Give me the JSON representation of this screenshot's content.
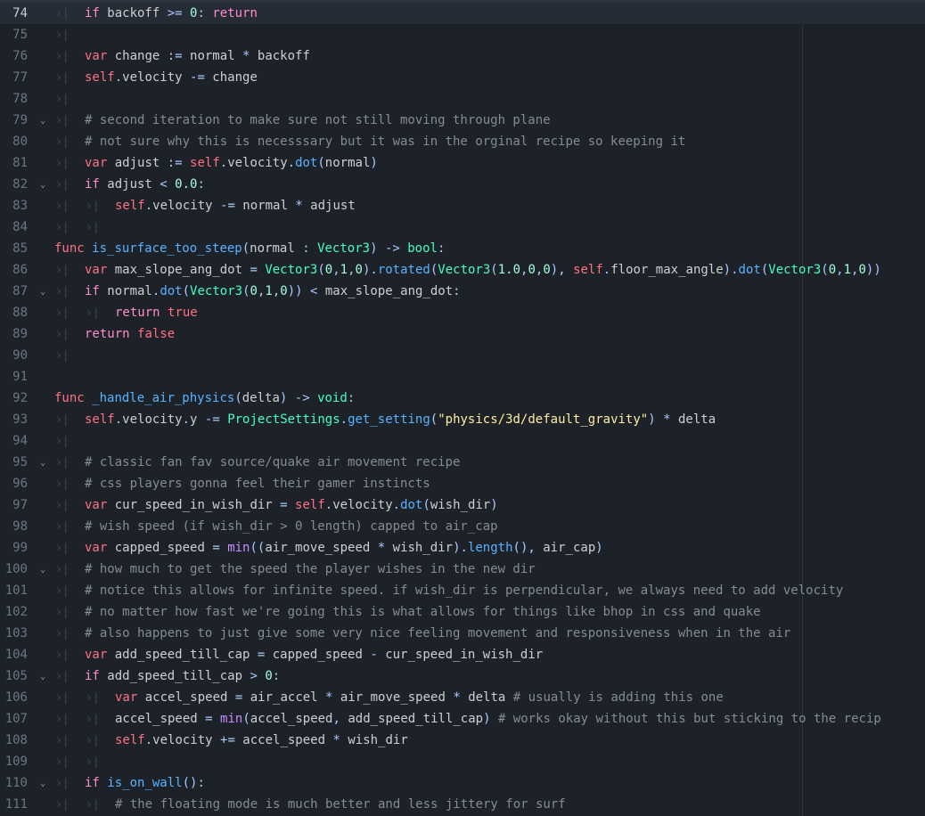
{
  "colors": {
    "background": "#1d2229",
    "current_line": "#262c35",
    "keyword": "#ff7085",
    "control_flow": "#ff8ccc",
    "function": "#57b3ff",
    "type": "#42ffc2",
    "number": "#a1ffe0",
    "string": "#ffeda1",
    "comment": "#858b94",
    "symbol": "#abc9ff",
    "text": "#cdcfd2"
  },
  "tab_marker_glyph": "›|",
  "fold_glyph": "⌄",
  "lines": [
    {
      "n": "74",
      "indent": 1,
      "current": true,
      "t": [
        [
          "ctrl",
          "if"
        ],
        [
          "plain",
          " backoff "
        ],
        [
          "sym",
          ">="
        ],
        [
          "plain",
          " "
        ],
        [
          "num",
          "0"
        ],
        [
          "sym",
          ":"
        ],
        [
          "plain",
          " "
        ],
        [
          "ctrl",
          "return"
        ]
      ]
    },
    {
      "n": "75",
      "indent": 1,
      "t": []
    },
    {
      "n": "76",
      "indent": 1,
      "t": [
        [
          "kw",
          "var"
        ],
        [
          "plain",
          " change "
        ],
        [
          "sym",
          ":="
        ],
        [
          "plain",
          " normal "
        ],
        [
          "sym",
          "*"
        ],
        [
          "plain",
          " backoff"
        ]
      ]
    },
    {
      "n": "77",
      "indent": 1,
      "t": [
        [
          "kw",
          "self"
        ],
        [
          "sym",
          "."
        ],
        [
          "plain",
          "velocity "
        ],
        [
          "sym",
          "-="
        ],
        [
          "plain",
          " change"
        ]
      ]
    },
    {
      "n": "78",
      "indent": 1,
      "t": []
    },
    {
      "n": "79",
      "indent": 1,
      "fold": true,
      "t": [
        [
          "comment",
          "# second iteration to make sure not still moving through plane"
        ]
      ]
    },
    {
      "n": "80",
      "indent": 1,
      "t": [
        [
          "comment",
          "# not sure why this is necesssary but it was in the orginal recipe so keeping it"
        ]
      ]
    },
    {
      "n": "81",
      "indent": 1,
      "t": [
        [
          "kw",
          "var"
        ],
        [
          "plain",
          " adjust "
        ],
        [
          "sym",
          ":="
        ],
        [
          "plain",
          " "
        ],
        [
          "kw",
          "self"
        ],
        [
          "sym",
          "."
        ],
        [
          "plain",
          "velocity"
        ],
        [
          "sym",
          "."
        ],
        [
          "method",
          "dot"
        ],
        [
          "sym",
          "("
        ],
        [
          "plain",
          "normal"
        ],
        [
          "sym",
          ")"
        ]
      ]
    },
    {
      "n": "82",
      "indent": 1,
      "fold": true,
      "t": [
        [
          "ctrl",
          "if"
        ],
        [
          "plain",
          " adjust "
        ],
        [
          "sym",
          "<"
        ],
        [
          "plain",
          " "
        ],
        [
          "num",
          "0.0"
        ],
        [
          "sym",
          ":"
        ]
      ]
    },
    {
      "n": "83",
      "indent": 2,
      "t": [
        [
          "kw",
          "self"
        ],
        [
          "sym",
          "."
        ],
        [
          "plain",
          "velocity "
        ],
        [
          "sym",
          "-="
        ],
        [
          "plain",
          " normal "
        ],
        [
          "sym",
          "*"
        ],
        [
          "plain",
          " adjust"
        ]
      ]
    },
    {
      "n": "84",
      "indent": 2,
      "t": []
    },
    {
      "n": "85",
      "indent": 0,
      "t": [
        [
          "kw",
          "func"
        ],
        [
          "plain",
          " "
        ],
        [
          "func",
          "is_surface_too_steep"
        ],
        [
          "sym",
          "("
        ],
        [
          "plain",
          "normal "
        ],
        [
          "sym",
          ":"
        ],
        [
          "plain",
          " "
        ],
        [
          "type",
          "Vector3"
        ],
        [
          "sym",
          ")"
        ],
        [
          "plain",
          " "
        ],
        [
          "sym",
          "->"
        ],
        [
          "plain",
          " "
        ],
        [
          "type",
          "bool"
        ],
        [
          "sym",
          ":"
        ]
      ]
    },
    {
      "n": "86",
      "indent": 1,
      "t": [
        [
          "kw",
          "var"
        ],
        [
          "plain",
          " max_slope_ang_dot "
        ],
        [
          "sym",
          "="
        ],
        [
          "plain",
          " "
        ],
        [
          "type",
          "Vector3"
        ],
        [
          "sym",
          "("
        ],
        [
          "num",
          "0"
        ],
        [
          "sym",
          ","
        ],
        [
          "num",
          "1"
        ],
        [
          "sym",
          ","
        ],
        [
          "num",
          "0"
        ],
        [
          "sym",
          ")."
        ],
        [
          "method",
          "rotated"
        ],
        [
          "sym",
          "("
        ],
        [
          "type",
          "Vector3"
        ],
        [
          "sym",
          "("
        ],
        [
          "num",
          "1.0"
        ],
        [
          "sym",
          ","
        ],
        [
          "num",
          "0"
        ],
        [
          "sym",
          ","
        ],
        [
          "num",
          "0"
        ],
        [
          "sym",
          "),"
        ],
        [
          "plain",
          " "
        ],
        [
          "kw",
          "self"
        ],
        [
          "sym",
          "."
        ],
        [
          "plain",
          "floor_max_angle"
        ],
        [
          "sym",
          ")."
        ],
        [
          "method",
          "dot"
        ],
        [
          "sym",
          "("
        ],
        [
          "type",
          "Vector3"
        ],
        [
          "sym",
          "("
        ],
        [
          "num",
          "0"
        ],
        [
          "sym",
          ","
        ],
        [
          "num",
          "1"
        ],
        [
          "sym",
          ","
        ],
        [
          "num",
          "0"
        ],
        [
          "sym",
          "))"
        ]
      ]
    },
    {
      "n": "87",
      "indent": 1,
      "fold": true,
      "t": [
        [
          "ctrl",
          "if"
        ],
        [
          "plain",
          " normal"
        ],
        [
          "sym",
          "."
        ],
        [
          "method",
          "dot"
        ],
        [
          "sym",
          "("
        ],
        [
          "type",
          "Vector3"
        ],
        [
          "sym",
          "("
        ],
        [
          "num",
          "0"
        ],
        [
          "sym",
          ","
        ],
        [
          "num",
          "1"
        ],
        [
          "sym",
          ","
        ],
        [
          "num",
          "0"
        ],
        [
          "sym",
          "))"
        ],
        [
          "plain",
          " "
        ],
        [
          "sym",
          "<"
        ],
        [
          "plain",
          " max_slope_ang_dot"
        ],
        [
          "sym",
          ":"
        ]
      ]
    },
    {
      "n": "88",
      "indent": 2,
      "t": [
        [
          "ctrl",
          "return"
        ],
        [
          "plain",
          " "
        ],
        [
          "kw",
          "true"
        ]
      ]
    },
    {
      "n": "89",
      "indent": 1,
      "t": [
        [
          "ctrl",
          "return"
        ],
        [
          "plain",
          " "
        ],
        [
          "kw",
          "false"
        ]
      ]
    },
    {
      "n": "90",
      "indent": 1,
      "t": []
    },
    {
      "n": "91",
      "indent": 0,
      "t": []
    },
    {
      "n": "92",
      "indent": 0,
      "t": [
        [
          "kw",
          "func"
        ],
        [
          "plain",
          " "
        ],
        [
          "func",
          "_handle_air_physics"
        ],
        [
          "sym",
          "("
        ],
        [
          "plain",
          "delta"
        ],
        [
          "sym",
          ")"
        ],
        [
          "plain",
          " "
        ],
        [
          "sym",
          "->"
        ],
        [
          "plain",
          " "
        ],
        [
          "type",
          "void"
        ],
        [
          "sym",
          ":"
        ]
      ]
    },
    {
      "n": "93",
      "indent": 1,
      "t": [
        [
          "kw",
          "self"
        ],
        [
          "sym",
          "."
        ],
        [
          "plain",
          "velocity"
        ],
        [
          "sym",
          "."
        ],
        [
          "plain",
          "y "
        ],
        [
          "sym",
          "-="
        ],
        [
          "plain",
          " "
        ],
        [
          "type",
          "ProjectSettings"
        ],
        [
          "sym",
          "."
        ],
        [
          "method",
          "get_setting"
        ],
        [
          "sym",
          "("
        ],
        [
          "str",
          "\"physics/3d/default_gravity\""
        ],
        [
          "sym",
          ")"
        ],
        [
          "plain",
          " "
        ],
        [
          "sym",
          "*"
        ],
        [
          "plain",
          " delta"
        ]
      ]
    },
    {
      "n": "94",
      "indent": 1,
      "t": []
    },
    {
      "n": "95",
      "indent": 1,
      "fold": true,
      "t": [
        [
          "comment",
          "# classic fan fav source/quake air movement recipe"
        ]
      ]
    },
    {
      "n": "96",
      "indent": 1,
      "t": [
        [
          "comment",
          "# css players gonna feel their gamer instincts"
        ]
      ]
    },
    {
      "n": "97",
      "indent": 1,
      "t": [
        [
          "kw",
          "var"
        ],
        [
          "plain",
          " cur_speed_in_wish_dir "
        ],
        [
          "sym",
          "="
        ],
        [
          "plain",
          " "
        ],
        [
          "kw",
          "self"
        ],
        [
          "sym",
          "."
        ],
        [
          "plain",
          "velocity"
        ],
        [
          "sym",
          "."
        ],
        [
          "method",
          "dot"
        ],
        [
          "sym",
          "("
        ],
        [
          "plain",
          "wish_dir"
        ],
        [
          "sym",
          ")"
        ]
      ]
    },
    {
      "n": "98",
      "indent": 1,
      "t": [
        [
          "comment",
          "# wish speed (if wish_dir > 0 length) capped to air_cap"
        ]
      ]
    },
    {
      "n": "99",
      "indent": 1,
      "t": [
        [
          "kw",
          "var"
        ],
        [
          "plain",
          " capped_speed "
        ],
        [
          "sym",
          "="
        ],
        [
          "plain",
          " "
        ],
        [
          "builtin",
          "min"
        ],
        [
          "sym",
          "(("
        ],
        [
          "plain",
          "air_move_speed "
        ],
        [
          "sym",
          "*"
        ],
        [
          "plain",
          " wish_dir"
        ],
        [
          "sym",
          ")."
        ],
        [
          "method",
          "length"
        ],
        [
          "sym",
          "(),"
        ],
        [
          "plain",
          " air_cap"
        ],
        [
          "sym",
          ")"
        ]
      ]
    },
    {
      "n": "100",
      "indent": 1,
      "fold": true,
      "t": [
        [
          "comment",
          "# how much to get the speed the player wishes in the new dir"
        ]
      ]
    },
    {
      "n": "101",
      "indent": 1,
      "t": [
        [
          "comment",
          "# notice this allows for infinite speed. if wish_dir is perpendicular, we always need to add velocity"
        ]
      ]
    },
    {
      "n": "102",
      "indent": 1,
      "t": [
        [
          "comment",
          "# no matter how fast we're going this is what allows for things like bhop in css and quake"
        ]
      ]
    },
    {
      "n": "103",
      "indent": 1,
      "t": [
        [
          "comment",
          "# also happens to just give some very nice feeling movement and responsiveness when in the air"
        ]
      ]
    },
    {
      "n": "104",
      "indent": 1,
      "t": [
        [
          "kw",
          "var"
        ],
        [
          "plain",
          " add_speed_till_cap "
        ],
        [
          "sym",
          "="
        ],
        [
          "plain",
          " capped_speed "
        ],
        [
          "sym",
          "-"
        ],
        [
          "plain",
          " cur_speed_in_wish_dir"
        ]
      ]
    },
    {
      "n": "105",
      "indent": 1,
      "fold": true,
      "t": [
        [
          "ctrl",
          "if"
        ],
        [
          "plain",
          " add_speed_till_cap "
        ],
        [
          "sym",
          ">"
        ],
        [
          "plain",
          " "
        ],
        [
          "num",
          "0"
        ],
        [
          "sym",
          ":"
        ]
      ]
    },
    {
      "n": "106",
      "indent": 2,
      "t": [
        [
          "kw",
          "var"
        ],
        [
          "plain",
          " accel_speed "
        ],
        [
          "sym",
          "="
        ],
        [
          "plain",
          " air_accel "
        ],
        [
          "sym",
          "*"
        ],
        [
          "plain",
          " air_move_speed "
        ],
        [
          "sym",
          "*"
        ],
        [
          "plain",
          " delta "
        ],
        [
          "comment",
          "# usually is adding this one"
        ]
      ]
    },
    {
      "n": "107",
      "indent": 2,
      "t": [
        [
          "plain",
          "accel_speed "
        ],
        [
          "sym",
          "="
        ],
        [
          "plain",
          " "
        ],
        [
          "builtin",
          "min"
        ],
        [
          "sym",
          "("
        ],
        [
          "plain",
          "accel_speed"
        ],
        [
          "sym",
          ","
        ],
        [
          "plain",
          " add_speed_till_cap"
        ],
        [
          "sym",
          ")"
        ],
        [
          "plain",
          " "
        ],
        [
          "comment",
          "# works okay without this but sticking to the recip"
        ]
      ]
    },
    {
      "n": "108",
      "indent": 2,
      "t": [
        [
          "kw",
          "self"
        ],
        [
          "sym",
          "."
        ],
        [
          "plain",
          "velocity "
        ],
        [
          "sym",
          "+="
        ],
        [
          "plain",
          " accel_speed "
        ],
        [
          "sym",
          "*"
        ],
        [
          "plain",
          " wish_dir"
        ]
      ]
    },
    {
      "n": "109",
      "indent": 2,
      "t": []
    },
    {
      "n": "110",
      "indent": 1,
      "fold": true,
      "t": [
        [
          "ctrl",
          "if"
        ],
        [
          "plain",
          " "
        ],
        [
          "method",
          "is_on_wall"
        ],
        [
          "sym",
          "():"
        ]
      ]
    },
    {
      "n": "111",
      "indent": 2,
      "t": [
        [
          "comment",
          "# the floating mode is much better and less jittery for surf"
        ]
      ]
    }
  ]
}
